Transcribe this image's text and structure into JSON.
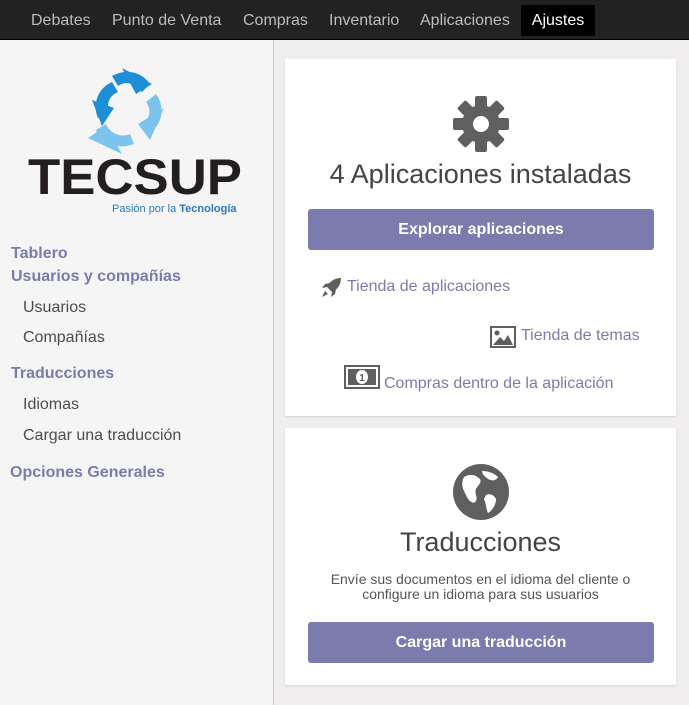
{
  "topnav": {
    "items": [
      "Debates",
      "Punto de Venta",
      "Compras",
      "Inventario",
      "Aplicaciones",
      "Ajustes"
    ],
    "active": "Ajustes"
  },
  "logo": {
    "brand": "TECSUP",
    "tagline_prefix": "Pasión por la ",
    "tagline_highlight": "Tecnología",
    "colors": {
      "arrow_dark": "#1e8fd6",
      "arrow_light": "#7cc4ee",
      "text": "#231f20",
      "tagline": "#2a78c0"
    }
  },
  "sidebar": {
    "tablero": "Tablero",
    "usuarios_companias": "Usuarios y compañías",
    "usuarios": "Usuarios",
    "companias": "Compañías",
    "traducciones": "Traducciones",
    "idiomas": "Idiomas",
    "cargar_traduccion": "Cargar una traducción",
    "opciones_generales": "Opciones Generales"
  },
  "apps_card": {
    "icon": "gear-icon",
    "title": "4 Aplicaciones instaladas",
    "button": "Explorar aplicaciones",
    "links": {
      "store": "Tienda de aplicaciones",
      "themes": "Tienda de temas",
      "iap": "Compras dentro de la aplicación"
    }
  },
  "translations_card": {
    "icon": "globe-icon",
    "title": "Traducciones",
    "desc_line1": "Envíe sus documentos en el idioma del cliente o",
    "desc_line2": "configure un idioma para sus usuarios",
    "button": "Cargar una traducción"
  },
  "colors": {
    "accent": "#7c7bad",
    "topbar": "#222222",
    "icon_gray": "#5f5f5f"
  }
}
